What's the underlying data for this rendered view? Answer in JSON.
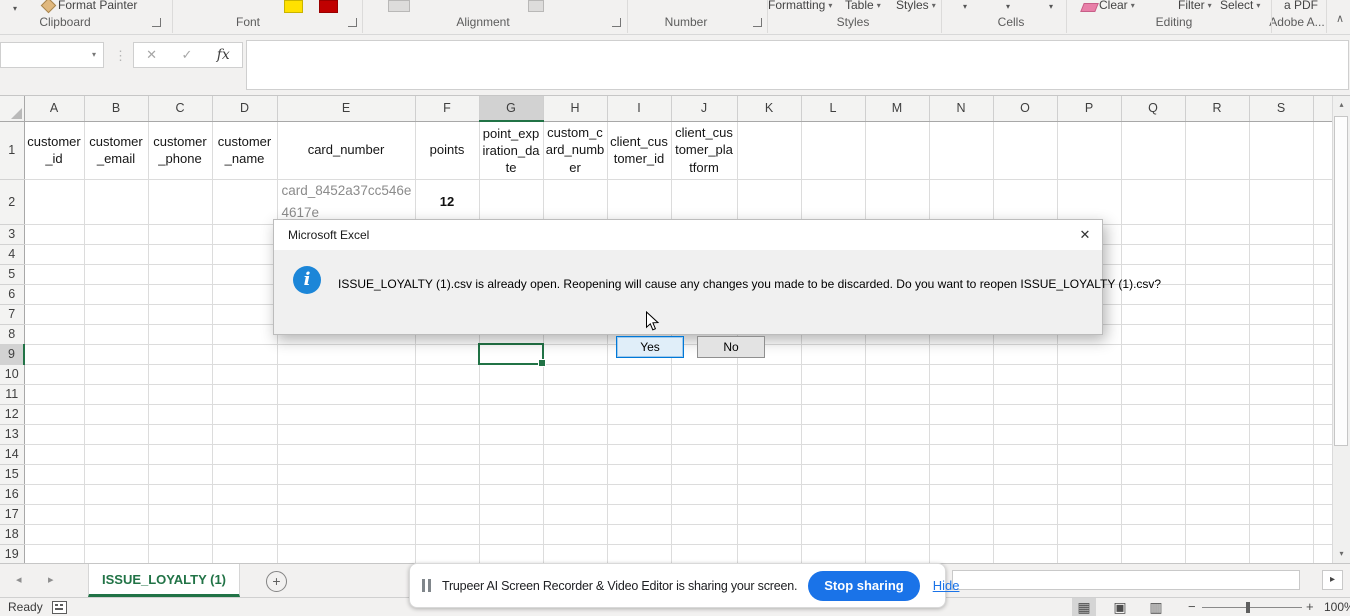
{
  "ribbon": {
    "format_painter_label": "Format Painter",
    "buttons": {
      "formatting": "Formatting",
      "table": "Table",
      "styles": "Styles",
      "clear": "Clear",
      "filter": "Filter",
      "select": "Select",
      "a_pdf": "a PDF"
    },
    "groups": {
      "clipboard": "Clipboard",
      "font": "Font",
      "alignment": "Alignment",
      "number": "Number",
      "styles": "Styles",
      "cells": "Cells",
      "editing": "Editing",
      "adobe": "Adobe A..."
    }
  },
  "formula_bar": {
    "name_box_value": ""
  },
  "grid": {
    "col_letters": [
      "A",
      "B",
      "C",
      "D",
      "E",
      "F",
      "G",
      "H",
      "I",
      "J",
      "K",
      "L",
      "M",
      "N",
      "O",
      "P",
      "Q",
      "R",
      "S"
    ],
    "row_count": 19,
    "row1_headers": [
      "customer_id",
      "customer_email",
      "customer_phone",
      "customer_name",
      "card_number",
      "points",
      "point_expiration_date",
      "custom_card_number",
      "client_customer_id",
      "client_customer_platform"
    ],
    "cells": [
      {
        "ref": "E2",
        "value": "card_8452a37cc546e4617e",
        "class": "muted-left"
      },
      {
        "ref": "F2",
        "value": "12",
        "class": "num"
      }
    ],
    "selected_cell": "G9",
    "selected_column": "G",
    "selected_row": 9
  },
  "dialog": {
    "title": "Microsoft Excel",
    "message": "ISSUE_LOYALTY (1).csv is already open. Reopening will cause any changes you made to be discarded. Do you want to reopen ISSUE_LOYALTY (1).csv?",
    "yes_label": "Yes",
    "no_label": "No"
  },
  "sheet_bar": {
    "active_tab": "ISSUE_LOYALTY (1)"
  },
  "status_bar": {
    "mode": "Ready",
    "zoom_level": "100%"
  },
  "share_bar": {
    "message": "Trupeer AI Screen Recorder & Video Editor is sharing your screen.",
    "stop_button": "Stop sharing",
    "hide_link": "Hide"
  },
  "icons": {
    "caret": "▾",
    "dots": "⋮",
    "cancel": "✕",
    "enter": "✓",
    "fx": "fx",
    "nav_left": "◂",
    "nav_right": "▸",
    "scroll_right": "▸",
    "scroll_up": "▴",
    "scroll_down": "▾",
    "plus": "+",
    "collapse": "∧",
    "close": "✕",
    "info": "i",
    "view_normal": "▦",
    "view_layout": "▣",
    "view_break": "▥",
    "zoom_out": "−",
    "zoom_in": "+"
  },
  "colors": {
    "excel_green": "#217346",
    "share_blue": "#1a73e8",
    "yes_border": "#0078d7",
    "info_blue": "#1c86d8"
  }
}
